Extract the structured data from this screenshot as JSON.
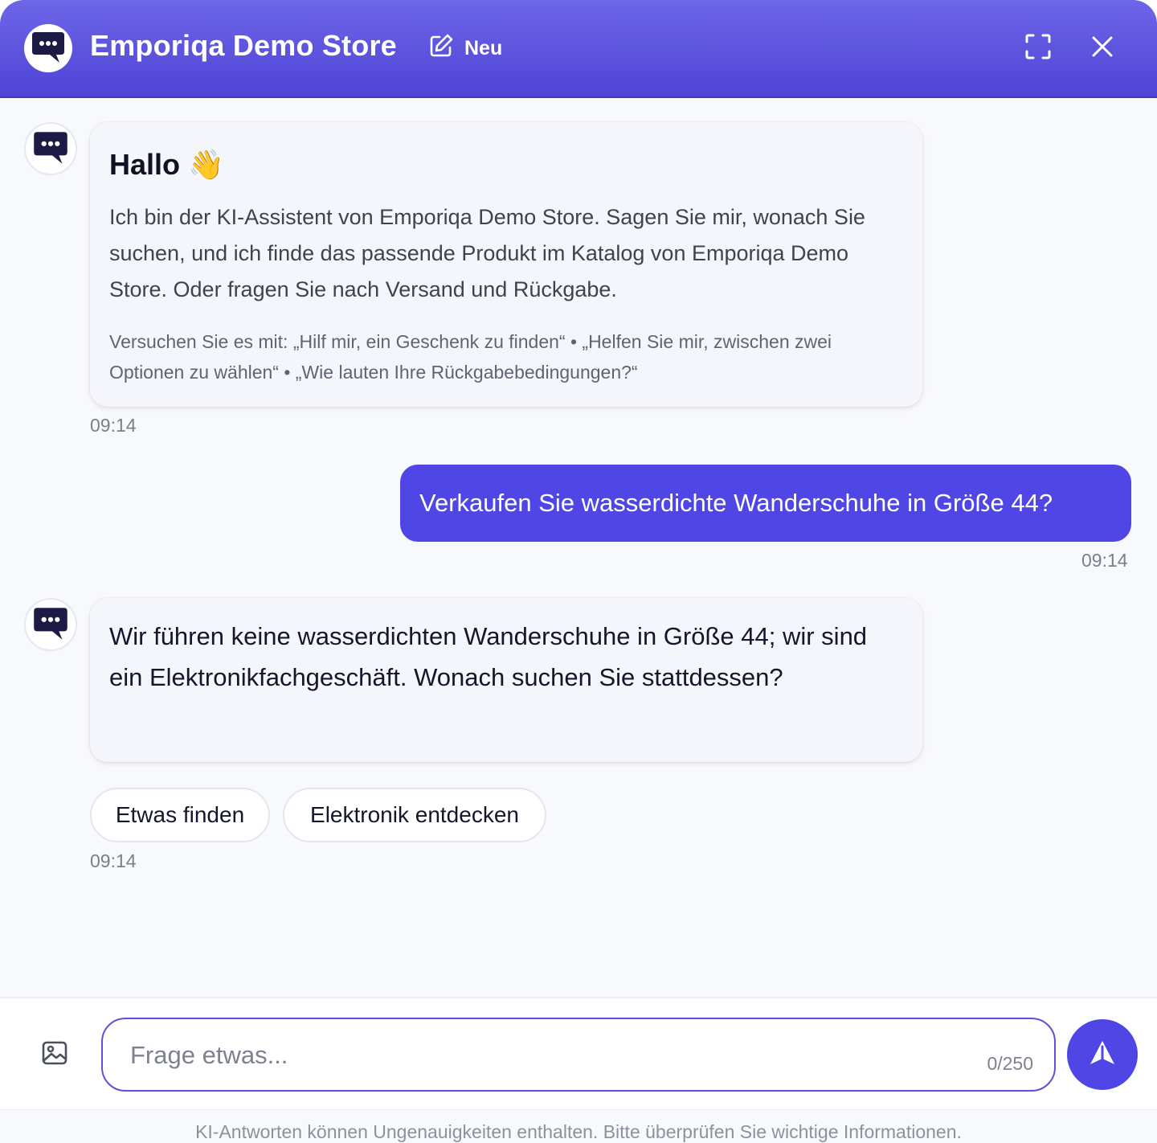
{
  "header": {
    "title": "Emporiqa Demo Store",
    "new_label": "Neu",
    "logo_icon": "chat-bubble-icon",
    "new_icon": "edit-icon",
    "expand_icon": "expand-icon",
    "close_icon": "close-icon"
  },
  "colors": {
    "accent": "#4f46e5",
    "header_top": "#6d66e8",
    "header_bottom": "#4f44d6",
    "avatar_dark": "#1c1b45"
  },
  "messages": [
    {
      "role": "assistant",
      "title": "Hallo",
      "title_emoji": "👋",
      "text": "Ich bin der KI-Assistent von Emporiqa Demo Store. Sagen Sie mir, wonach Sie suchen, und ich finde das passende Produkt im Katalog von Emporiqa Demo Store. Oder fragen Sie nach Versand und Rückgabe.",
      "hint": "Versuchen Sie es mit: „Hilf mir, ein Geschenk zu finden“ • „Helfen Sie mir, zwischen zwei Optionen zu wählen“ • „Wie lauten Ihre Rückgabebedingungen?“",
      "time": "09:14"
    },
    {
      "role": "user",
      "text": "Verkaufen Sie wasserdichte Wanderschuhe in Größe 44?",
      "time": "09:14"
    },
    {
      "role": "assistant",
      "text": "Wir führen keine wasserdichten Wanderschuhe in Größe 44; wir sind ein Elektronikfachgeschäft. Wonach suchen Sie stattdessen?",
      "time": "09:14",
      "suggestions": [
        "Etwas finden",
        "Elektronik entdecken"
      ]
    }
  ],
  "input": {
    "placeholder": "Frage etwas...",
    "value": "",
    "char_count": "0/250",
    "image_icon": "image-icon",
    "send_icon": "send-icon"
  },
  "footer": {
    "disclaimer": "KI-Antworten können Ungenauigkeiten enthalten. Bitte überprüfen Sie wichtige Informationen."
  }
}
